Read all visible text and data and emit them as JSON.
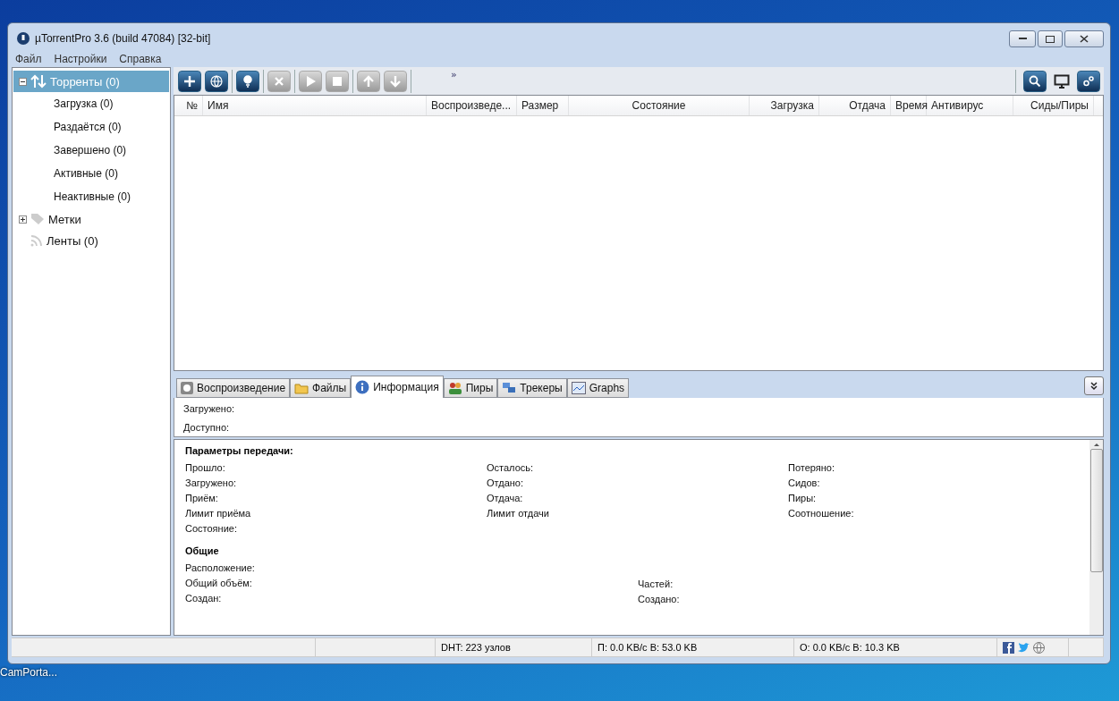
{
  "window": {
    "title": "µTorrentPro 3.6  (build 47084) [32-bit]"
  },
  "menu": [
    "Файл",
    "Настройки",
    "Справка"
  ],
  "sidebar": {
    "items": [
      {
        "label": "Торренты (0)",
        "kind": "torrents",
        "selected": true,
        "expanded": true,
        "children": [
          {
            "label": "Загрузка (0)",
            "selected": false
          },
          {
            "label": "Раздаётся (0)",
            "selected": false
          },
          {
            "label": "Завершено (0)",
            "selected": false
          },
          {
            "label": "Активные (0)",
            "selected": false
          },
          {
            "label": "Неактивные (0)",
            "selected": false
          }
        ]
      },
      {
        "label": "Метки",
        "kind": "labels",
        "selected": false,
        "expanded": false
      },
      {
        "label": "Ленты (0)",
        "kind": "feeds",
        "selected": false
      }
    ]
  },
  "toolbar": {
    "left": [
      {
        "kind": "add",
        "disabled": false
      },
      {
        "kind": "add-url",
        "disabled": false
      },
      {
        "kind": "sep"
      },
      {
        "kind": "create",
        "disabled": false
      },
      {
        "kind": "sep"
      },
      {
        "kind": "remove",
        "disabled": true
      },
      {
        "kind": "sep"
      },
      {
        "kind": "start",
        "disabled": true
      },
      {
        "kind": "stop",
        "disabled": true
      },
      {
        "kind": "sep"
      },
      {
        "kind": "up",
        "disabled": true
      },
      {
        "kind": "down",
        "disabled": true
      },
      {
        "kind": "sep"
      }
    ],
    "overflow": "»",
    "right": [
      {
        "kind": "search",
        "disabled": false
      },
      {
        "kind": "monitor",
        "disabled": false
      },
      {
        "kind": "settings",
        "disabled": false
      }
    ]
  },
  "table": {
    "columns": [
      "№",
      "Имя",
      "Воспроизведе...",
      "Размер",
      "Состояние",
      "Загрузка",
      "Отдача",
      "Время",
      "Антивирус",
      "Сиды/Пиры"
    ]
  },
  "tabs": [
    {
      "label": "Воспроизведение",
      "kind": "play",
      "selected": false
    },
    {
      "label": "Файлы",
      "kind": "files",
      "selected": false
    },
    {
      "label": "Информация",
      "kind": "info",
      "selected": true
    },
    {
      "label": "Пиры",
      "kind": "peers",
      "selected": false
    },
    {
      "label": "Трекеры",
      "kind": "trackers",
      "selected": false
    },
    {
      "label": "Graphs",
      "kind": "graphs",
      "selected": false
    }
  ],
  "info": {
    "top": [
      "Загружено:",
      "Доступно:"
    ],
    "transfer": {
      "title": "Параметры передачи:",
      "columns": [
        [
          "Прошло:",
          "Загружено:",
          "Приём:",
          "Лимит приёма",
          "Состояние:"
        ],
        [
          "Осталось:",
          "Отдано:",
          "Отдача:",
          "Лимит отдачи"
        ],
        [
          "Потеряно:",
          "Сидов:",
          "Пиры:",
          "Соотношение:"
        ]
      ]
    },
    "general": {
      "title": "Общие",
      "columns": [
        [
          "Расположение:",
          "Общий объём:",
          "Создан:"
        ],
        [
          "Частей:",
          "Создано:"
        ]
      ]
    }
  },
  "status_bar": {
    "dht": "DHT: 223 узлов",
    "download": "П: 0.0 KB/с В: 53.0 KB",
    "upload": "О: 0.0 KB/с В: 10.3 KB"
  },
  "desktop": {
    "icon_label": "CamPorta..."
  }
}
